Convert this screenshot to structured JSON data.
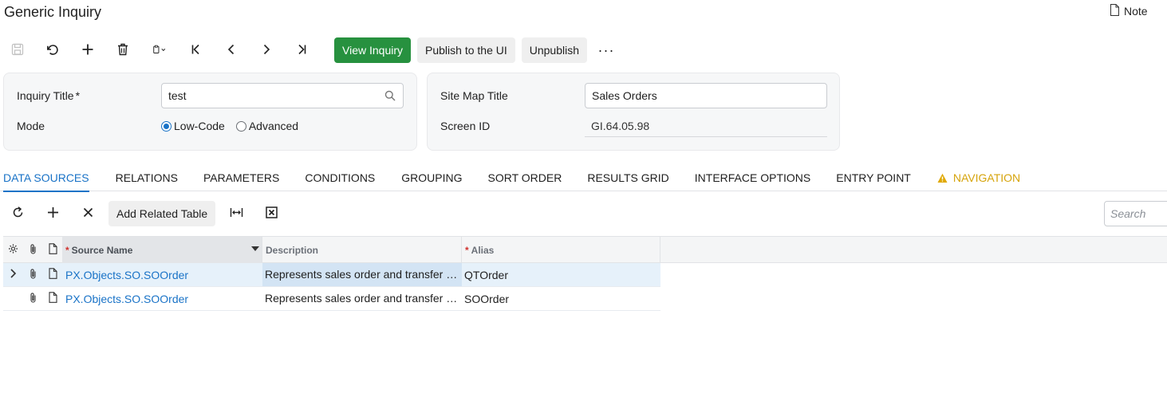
{
  "page": {
    "title": "Generic Inquiry",
    "note_label": "Note"
  },
  "toolbar": {
    "view_inquiry_label": "View Inquiry",
    "publish_label": "Publish to the UI",
    "unpublish_label": "Unpublish",
    "more_label": "···"
  },
  "form": {
    "inquiry_title_label": "Inquiry Title",
    "inquiry_title_required": "*",
    "inquiry_title_value": "test",
    "mode_label": "Mode",
    "mode_options": [
      "Low-Code",
      "Advanced"
    ],
    "mode_selected": "Low-Code",
    "site_map_title_label": "Site Map Title",
    "site_map_title_value": "Sales Orders",
    "screen_id_label": "Screen ID",
    "screen_id_value": "GI.64.05.98"
  },
  "tabs": [
    {
      "label": "DATA SOURCES",
      "state": "active"
    },
    {
      "label": "RELATIONS"
    },
    {
      "label": "PARAMETERS"
    },
    {
      "label": "CONDITIONS"
    },
    {
      "label": "GROUPING"
    },
    {
      "label": "SORT ORDER"
    },
    {
      "label": "RESULTS GRID"
    },
    {
      "label": "INTERFACE OPTIONS"
    },
    {
      "label": "ENTRY POINT"
    },
    {
      "label": "NAVIGATION",
      "state": "warning"
    }
  ],
  "grid_toolbar": {
    "add_related_table_label": "Add Related Table",
    "search_placeholder": "Search"
  },
  "grid": {
    "columns": [
      {
        "label": "Source Name",
        "required": "*"
      },
      {
        "label": "Description"
      },
      {
        "label": "Alias",
        "required": "*"
      }
    ],
    "rows": [
      {
        "source_name": "PX.Objects.SO.SOOrder",
        "description": "Represents sales order and transfer …",
        "alias": "QTOrder"
      },
      {
        "source_name": "PX.Objects.SO.SOOrder",
        "description": "Represents sales order and transfer …",
        "alias": "SOOrder"
      }
    ]
  },
  "colors": {
    "accent": "#1a73c7",
    "primary_button": "#27913f",
    "warning": "#d6a40c",
    "required": "#d0312d"
  }
}
